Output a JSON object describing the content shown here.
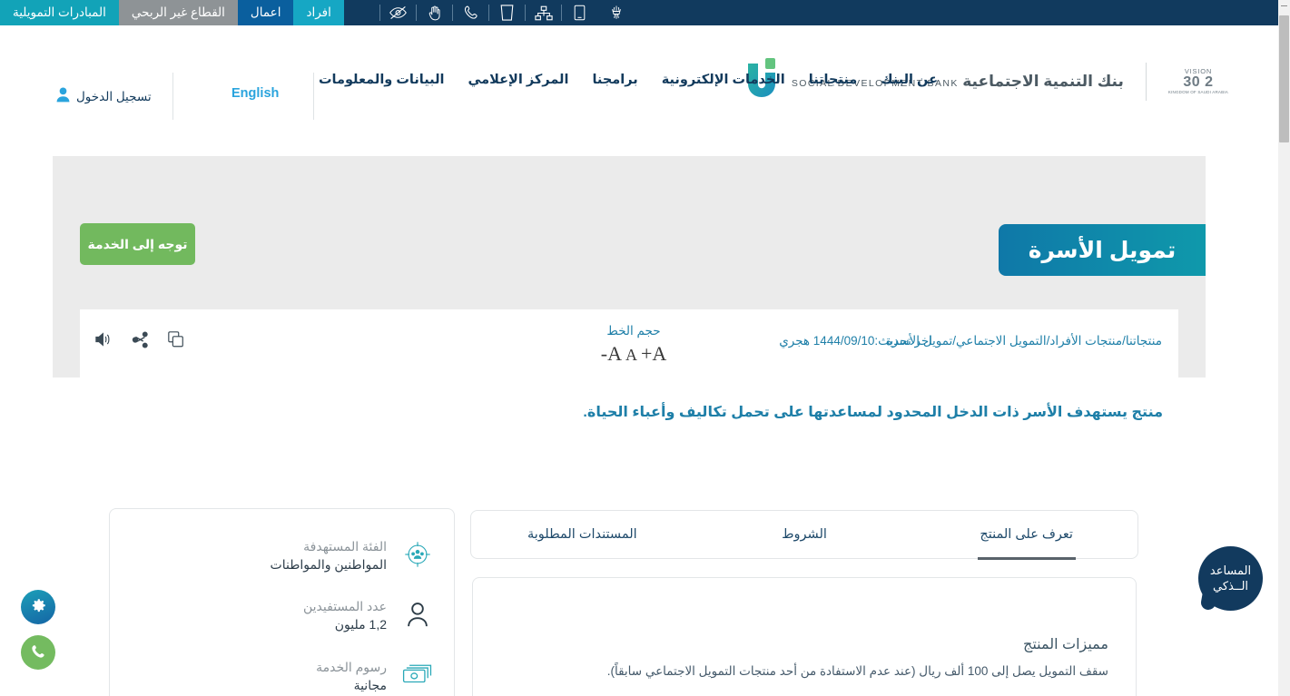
{
  "topbar": {
    "segments": [
      {
        "label": "افراد",
        "key": "individuals",
        "color": "#16a7c4"
      },
      {
        "label": "اعمال",
        "key": "business",
        "color": "#0a5f9e"
      },
      {
        "label": "القطاع غير الربحي",
        "key": "non-profit",
        "color": "#8e9396"
      },
      {
        "label": "المبادرات التمويلية",
        "key": "financing-initiatives",
        "color": "#12a3b8"
      }
    ],
    "icons": [
      "eye-slash-icon",
      "sign-language-icon",
      "phone-icon",
      "document-icon",
      "sitemap-icon",
      "mobile-icon",
      "emblem-icon"
    ],
    "background": "#113a5e"
  },
  "header": {
    "logo": {
      "name_ar": "بنك التنمية الاجتماعية",
      "name_en": "SOCIAL DEVELOPMENT BANK",
      "vision_top": "VISION",
      "vision_num": "2 30",
      "vision_sub": "KINGDOM OF SAUDI ARABIA"
    },
    "nav": [
      {
        "label": "عن البنك",
        "key": "about-bank"
      },
      {
        "label": "منتجاتنا",
        "key": "our-products"
      },
      {
        "label": "الخدمات الإلكترونية",
        "key": "e-services"
      },
      {
        "label": "برامجنا",
        "key": "our-programs"
      },
      {
        "label": "المركز الإعلامي",
        "key": "media-center"
      },
      {
        "label": "البيانات والمعلومات",
        "key": "data-information"
      }
    ],
    "language_link": "English",
    "login_label": "تسجيل الدخول",
    "accent": "#123a5c",
    "link_color": "#2aa4dd"
  },
  "hero": {
    "title": "تمويل الأسرة",
    "cta_label": "توجه إلى الخدمة",
    "cta_color": "#72b95e",
    "title_gradient_from": "#0f99ab",
    "title_gradient_to": "#0f78a8",
    "band_color": "#ebebeb"
  },
  "utility_strip": {
    "breadcrumb": "منتجاتنا/منتجات الأفراد/التمويل الاجتماعي/تمويل الأسرة",
    "last_updated": "اخر تحديث:1444/09/10 هجري",
    "font_size_label": "حجم الخط",
    "font_decrease": "A-",
    "font_normal": "A",
    "font_increase": "A+",
    "icons": [
      "copy-icon",
      "share-icon",
      "speaker-icon"
    ],
    "text_color": "#1e7fa8"
  },
  "description": "منتج يستهدف الأسر ذات الدخل المحدود لمساعدتها على تحمل تكاليف وأعباء الحياة.",
  "tabs": [
    {
      "label": "تعرف على المنتج",
      "key": "about-product",
      "active": true
    },
    {
      "label": "الشروط",
      "key": "conditions",
      "active": false
    },
    {
      "label": "المستندات المطلوبة",
      "key": "required-documents",
      "active": false
    }
  ],
  "content": {
    "heading": "مميزات المنتج",
    "paragraph": "سقف التمويل يصل إلى 100 ألف ريال (عند عدم الاستفادة من أحد منتجات التمويل الاجتماعي سابقاً)."
  },
  "info_card": {
    "rows": [
      {
        "icon": "target-audience-icon",
        "label": "الفئة المستهدفة",
        "value": "المواطنين والمواطنات"
      },
      {
        "icon": "beneficiaries-icon",
        "label": "عدد المستفيدين",
        "value": "1,2 مليون"
      },
      {
        "icon": "service-fees-icon",
        "label": "رسوم الخدمة",
        "value": "مجانية"
      }
    ]
  },
  "floating": {
    "gear_icon": "gear-icon",
    "phone_icon": "phone-icon",
    "assistant_line1": "المساعد",
    "assistant_line2": "الــذكي",
    "assistant_color": "#123a5e"
  }
}
